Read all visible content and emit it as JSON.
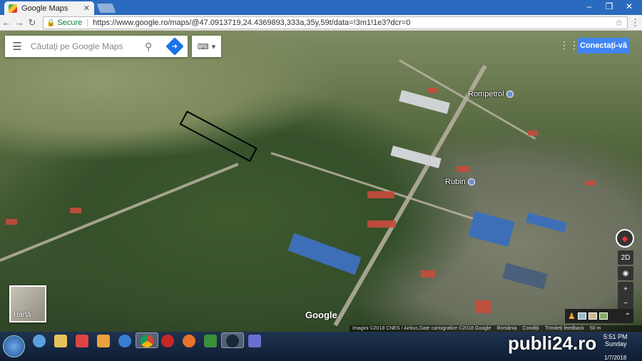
{
  "browser": {
    "tab_title": "Google Maps",
    "secure_label": "Secure",
    "url": "https://www.google.ro/maps/@47.0913719,24.4369893,333a,35y,59t/data=!3m1!1e3?dcr=0"
  },
  "maps": {
    "search_placeholder": "Căutați pe Google Maps",
    "sign_in_label": "Conectați-vă",
    "layers_label": "Hartă",
    "google_logo": "Google",
    "view_2d_label": "2D",
    "poi": [
      {
        "name": "Rompetrol"
      },
      {
        "name": "Rubin"
      }
    ],
    "footer": {
      "imagery": "Imagini ©2018 CNES / Airbus,Date cartografice ©2018 Google",
      "country": "România",
      "terms": "Condiții",
      "feedback": "Trimiteți feedback",
      "scale": "50 m"
    }
  },
  "taskbar": {
    "time": "5:51 PM",
    "day": "Sunday",
    "date": "1/7/2018"
  },
  "watermark": {
    "text_a": "publi",
    "text_num": "24",
    "text_b": ".ro"
  },
  "colors": {
    "accent": "#4285f4",
    "tabbar": "#2b6bbf",
    "outline_field": "#000000"
  }
}
